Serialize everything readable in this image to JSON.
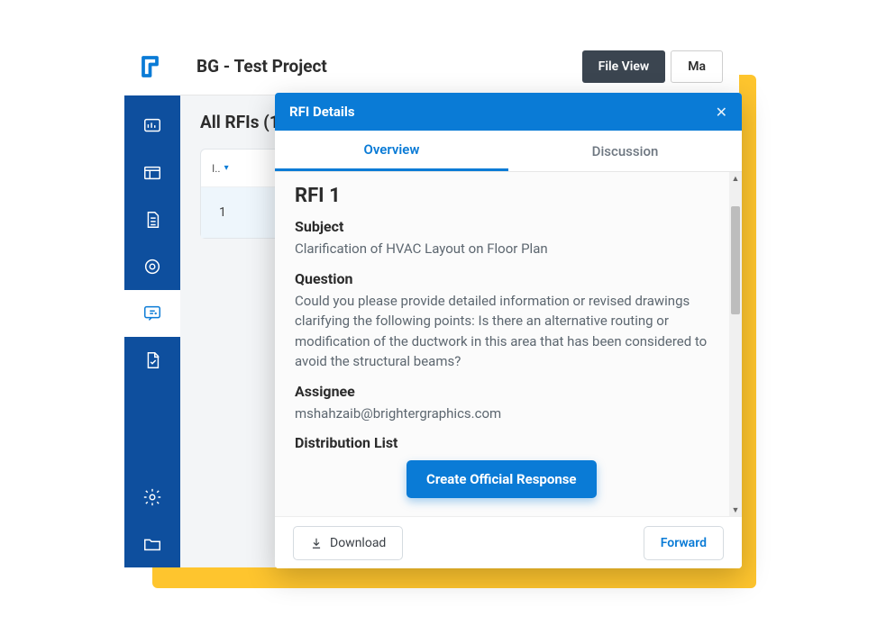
{
  "project_title": "BG - Test Project",
  "header_buttons": {
    "file_view": "File View",
    "ma": "Ma"
  },
  "list": {
    "title": "All RFIs (1)",
    "col_header": "I..",
    "row_id": "1"
  },
  "modal": {
    "title": "RFI Details",
    "tabs": {
      "overview": "Overview",
      "discussion": "Discussion"
    },
    "rfi_title": "RFI 1",
    "subject_label": "Subject",
    "subject_value": "Clarification of HVAC Layout on Floor Plan",
    "question_label": "Question",
    "question_value": "Could you please provide detailed information or revised drawings clarifying the following points: Is there an alternative routing or modification of the ductwork in this area that has been considered to avoid the structural beams?",
    "assignee_label": "Assignee",
    "assignee_value": "mshahzaib@brightergraphics.com",
    "distribution_label": "Distribution List",
    "footer": {
      "download": "Download",
      "forward": "Forward"
    }
  },
  "action_button": "Create Official Response"
}
